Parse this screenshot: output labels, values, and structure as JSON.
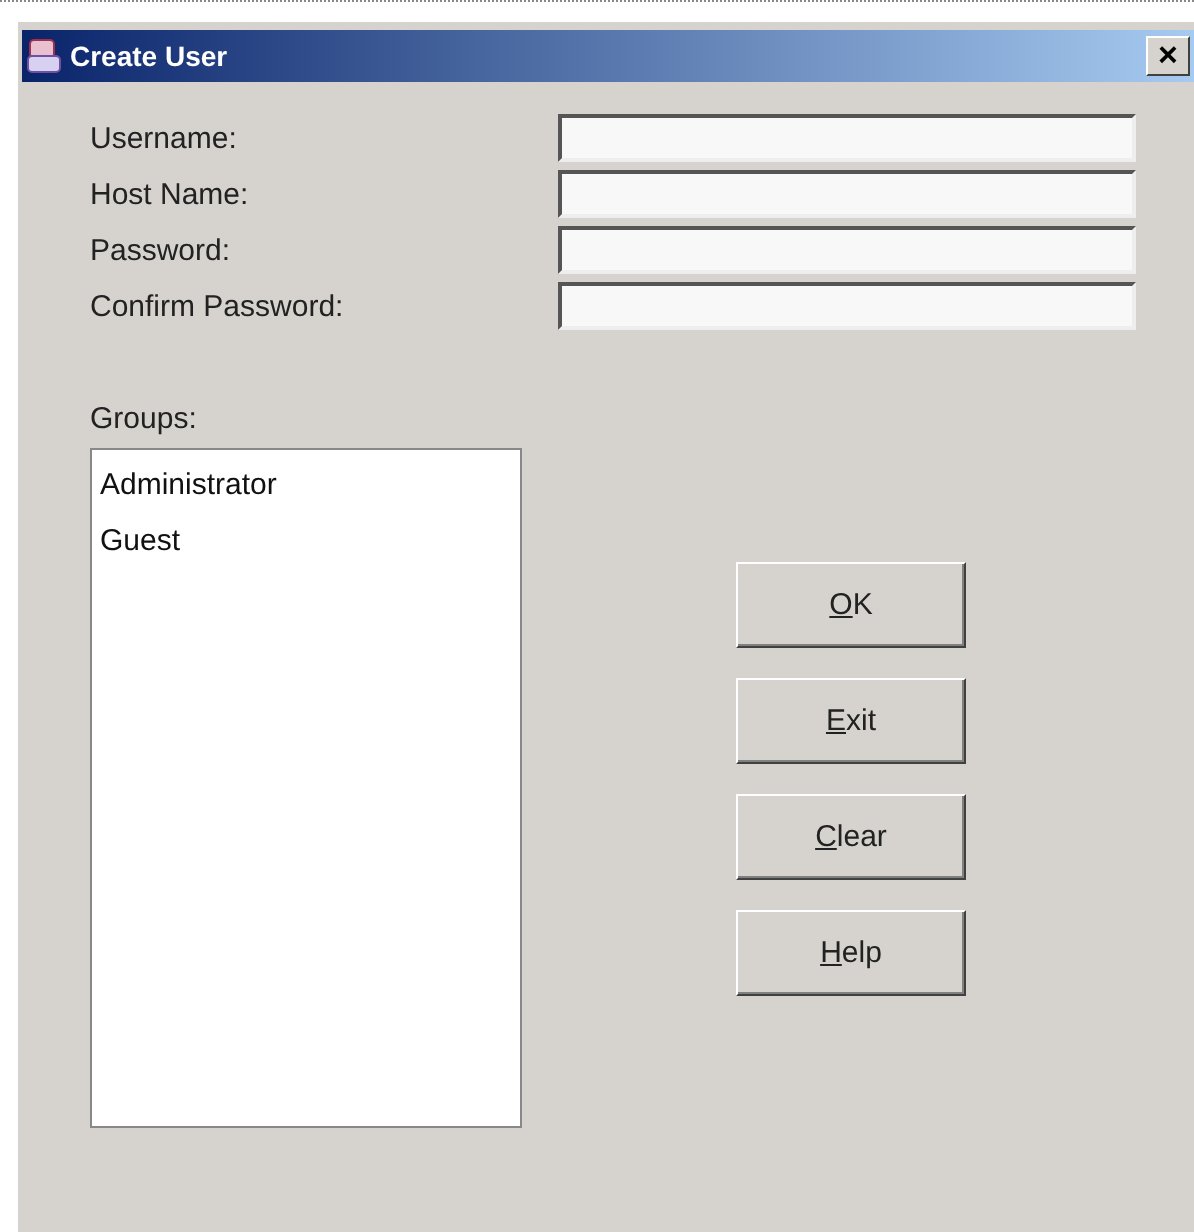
{
  "window": {
    "title": "Create User",
    "close": "×"
  },
  "fields": [
    {
      "label": "Username:"
    },
    {
      "label": "Host Name:"
    },
    {
      "label": "Password:"
    },
    {
      "label": "Confirm Password:"
    }
  ],
  "groups": {
    "label": "Groups:",
    "items": [
      {
        "name": "Administrator",
        "selected": false
      },
      {
        "name": "Guest",
        "selected": false
      }
    ]
  },
  "buttons": [
    {
      "label": "OK",
      "underline_first": true
    },
    {
      "label": "Exit",
      "underline_first": true
    },
    {
      "label": "Clear",
      "underline_first": true
    },
    {
      "label": "Help",
      "underline_first": true
    }
  ]
}
